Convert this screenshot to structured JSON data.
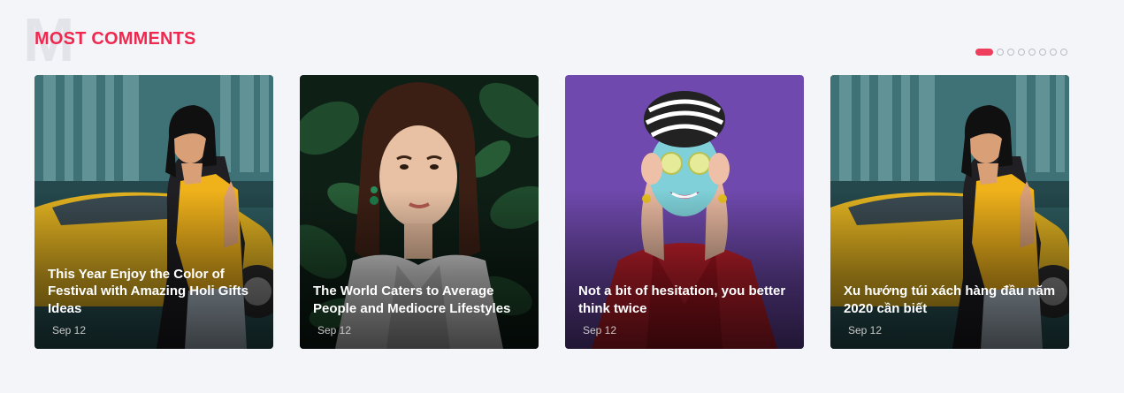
{
  "section": {
    "watermark_letter": "M",
    "title": "MOST COMMENTS"
  },
  "pagination": {
    "total_dots": 8,
    "active_index": 0
  },
  "colors": {
    "accent": "#f0284f",
    "dot_active": "#ef3e5d",
    "dot_inactive": "#b9bcc4",
    "background": "#f4f5f9"
  },
  "cards": [
    {
      "title": "This Year Enjoy the Color of Festival with Amazing Holi Gifts Ideas",
      "date": "Sep 12",
      "image": "woman-yellow-car-photo"
    },
    {
      "title": "The World Caters to Average People and Mediocre Lifestyles",
      "date": "Sep 12",
      "image": "woman-leaves-portrait-photo"
    },
    {
      "title": "Not a bit of hesitation, you better think twice",
      "date": "Sep 12",
      "image": "woman-face-mask-photo"
    },
    {
      "title": "Xu hướng túi xách hàng đầu năm 2020 cần biết",
      "date": "Sep 12",
      "image": "woman-yellow-car-photo"
    }
  ]
}
